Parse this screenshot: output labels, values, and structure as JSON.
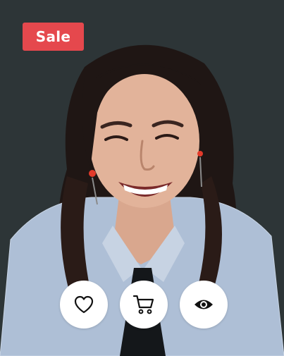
{
  "product": {
    "badge_label": "Sale",
    "badge_color": "#e5484d"
  },
  "actions": [
    {
      "name": "wishlist",
      "icon": "heart-icon"
    },
    {
      "name": "add-to-cart",
      "icon": "cart-icon"
    },
    {
      "name": "quick-view",
      "icon": "eye-icon"
    }
  ]
}
